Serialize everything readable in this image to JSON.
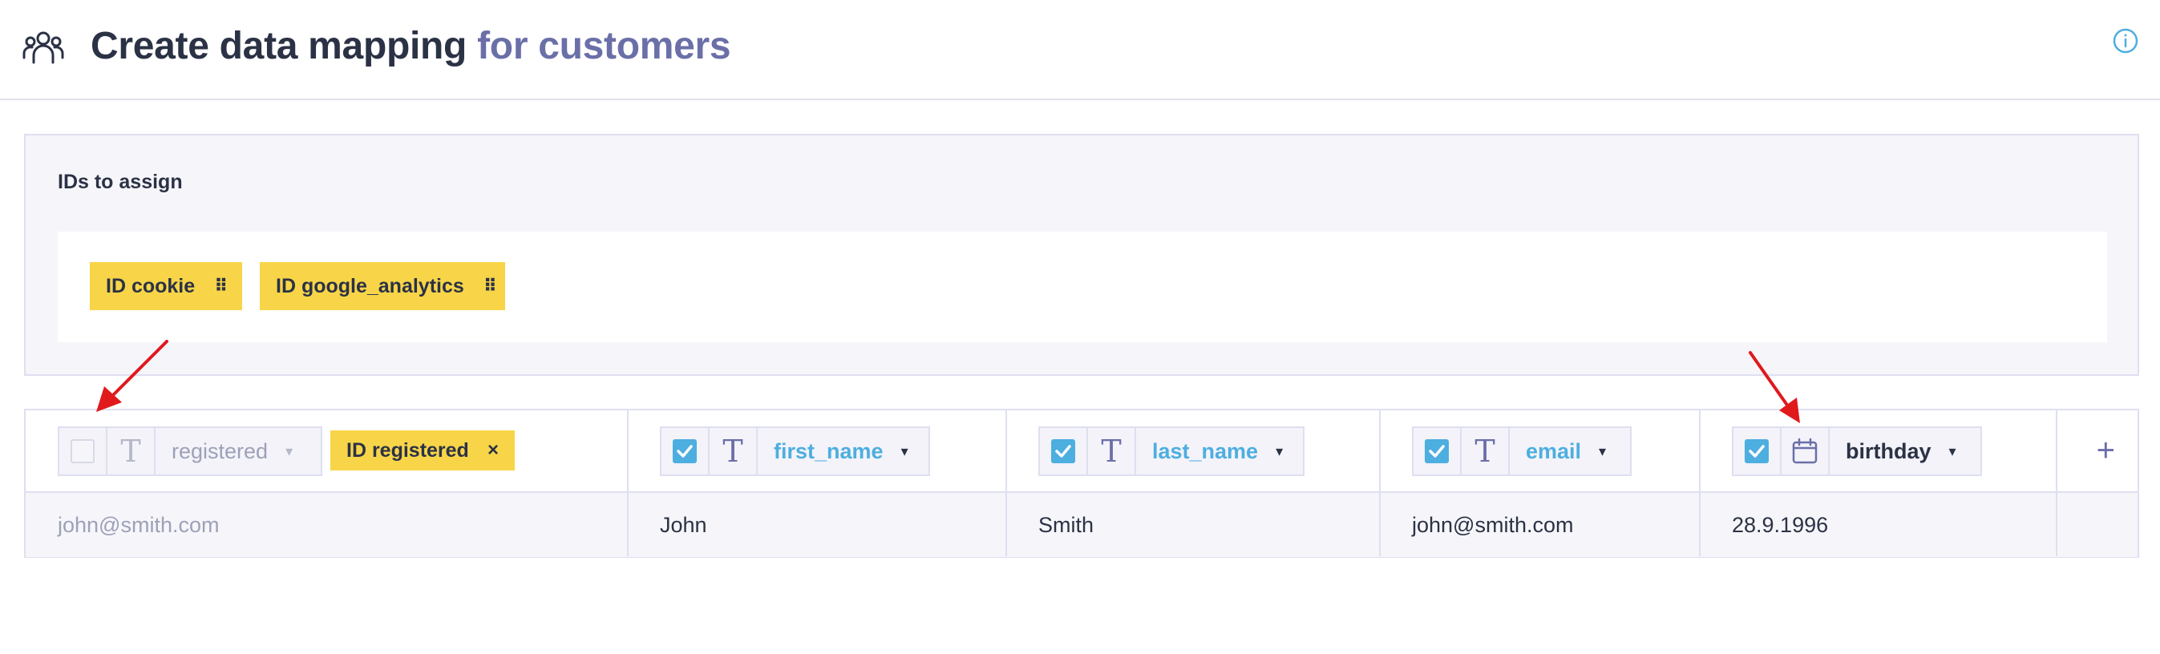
{
  "header": {
    "title_main": "Create data mapping",
    "title_sub": "for customers",
    "icon": "people-group-icon",
    "info_icon": "info-icon"
  },
  "ids_panel": {
    "label": "IDs to assign",
    "chips": [
      {
        "label": "ID cookie",
        "grip": "⠿"
      },
      {
        "label": "ID google_analytics",
        "grip": "⠿"
      }
    ]
  },
  "table": {
    "columns": [
      {
        "checked": false,
        "type_icon": "T",
        "field": "registered",
        "tag": "ID registered",
        "tag_close": "×",
        "value": "john@smith.com"
      },
      {
        "checked": true,
        "type_icon": "T",
        "field": "first_name",
        "value": "John"
      },
      {
        "checked": true,
        "type_icon": "T",
        "field": "last_name",
        "value": "Smith"
      },
      {
        "checked": true,
        "type_icon": "T",
        "field": "email",
        "value": "john@smith.com"
      },
      {
        "checked": true,
        "type_icon": "calendar-icon",
        "field": "birthday",
        "value": "28.9.1996"
      }
    ],
    "add_column": "+",
    "caret": "▾"
  },
  "colors": {
    "accent_blue": "#4daee0",
    "chip_yellow": "#f8d548",
    "title_purple": "#6b6fa8",
    "annotation_red": "#e0191d"
  }
}
